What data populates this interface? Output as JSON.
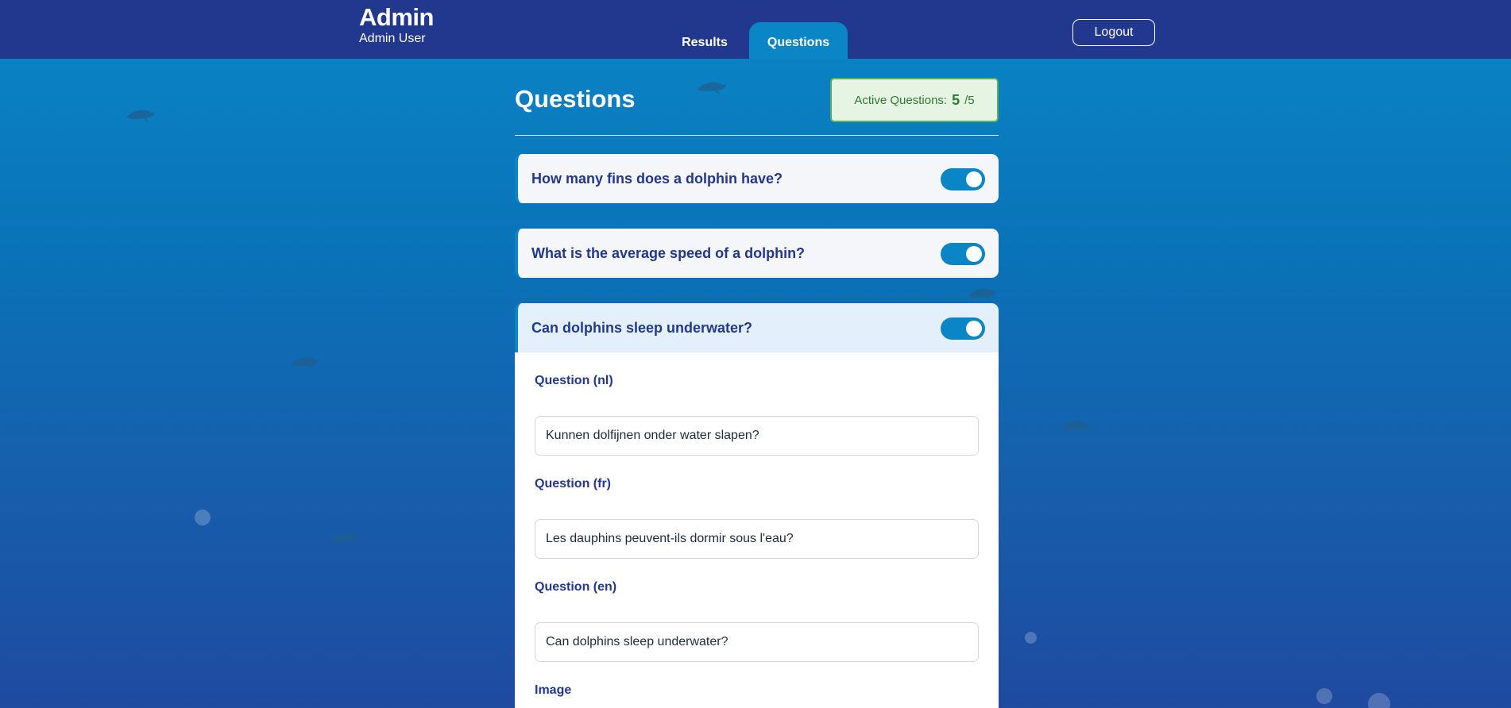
{
  "header": {
    "title": "Admin",
    "user": "Admin User",
    "tabs": [
      {
        "label": "Results",
        "active": false
      },
      {
        "label": "Questions",
        "active": true
      }
    ],
    "logout_label": "Logout"
  },
  "main": {
    "title": "Questions",
    "active_questions": {
      "label": "Active Questions:",
      "count": "5",
      "total": "/5"
    },
    "questions": [
      {
        "text": "How many fins does a dolphin have?",
        "enabled": true,
        "expanded": false
      },
      {
        "text": "What is the average speed of a dolphin?",
        "enabled": true,
        "expanded": false
      },
      {
        "text": "Can dolphins sleep underwater?",
        "enabled": true,
        "expanded": true
      }
    ],
    "detail": {
      "fields": [
        {
          "label": "Question (nl)",
          "value": "Kunnen dolfijnen onder water slapen?"
        },
        {
          "label": "Question (fr)",
          "value": "Les dauphins peuvent-ils dormir sous l'eau?"
        },
        {
          "label": "Question (en)",
          "value": "Can dolphins sleep underwater?"
        }
      ],
      "image_label": "Image"
    }
  },
  "colors": {
    "header_bg": "#22388f",
    "accent": "#0a86c6",
    "question_text": "#22388f",
    "active_bg": "#e6f4e3",
    "active_border": "#59b05b"
  }
}
